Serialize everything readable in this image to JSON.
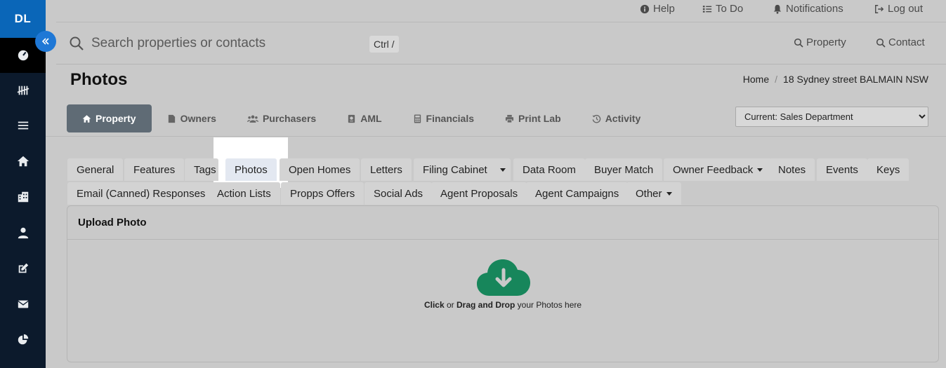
{
  "sidebar": {
    "brand": "DL",
    "items": [
      {
        "icon": "dashboard-icon"
      },
      {
        "icon": "tally-icon"
      },
      {
        "icon": "list-icon"
      },
      {
        "icon": "home-icon"
      },
      {
        "icon": "building-icon"
      },
      {
        "icon": "user-icon"
      },
      {
        "icon": "edit-icon"
      },
      {
        "icon": "envelope-icon"
      },
      {
        "icon": "pie-chart-icon"
      }
    ]
  },
  "utilbar": {
    "help": "Help",
    "todo": "To Do",
    "notifications": "Notifications",
    "logout": "Log out"
  },
  "search": {
    "placeholder": "Search properties or contacts",
    "shortcut": "Ctrl /",
    "property_link": "Property",
    "contact_link": "Contact"
  },
  "page": {
    "title": "Photos",
    "breadcrumb": [
      "Home",
      "18 Sydney street BALMAIN NSW"
    ]
  },
  "main_tabs": [
    {
      "label": "Property",
      "icon": "home-icon",
      "active": true
    },
    {
      "label": "Owners",
      "icon": "file-icon"
    },
    {
      "label": "Purchasers",
      "icon": "users-icon"
    },
    {
      "label": "AML",
      "icon": "passport-icon"
    },
    {
      "label": "Financials",
      "icon": "calculator-icon"
    },
    {
      "label": "Print Lab",
      "icon": "printer-icon"
    },
    {
      "label": "Activity",
      "icon": "history-icon"
    }
  ],
  "department": {
    "selected": "Current: Sales Department"
  },
  "sub_tabs_row1": [
    "General",
    "Features",
    "Tags",
    "Photos",
    "Open Homes",
    "Letters",
    "Filing Cabinet",
    "Data Room",
    "Buyer Match",
    "Owner Feedback",
    "Notes",
    "Events",
    "Keys"
  ],
  "sub_tabs_row2": [
    "Email (Canned) Responses",
    "Action Lists",
    "Propps Offers",
    "Social Ads",
    "Agent Proposals",
    "Agent Campaigns",
    "Other"
  ],
  "upload": {
    "title": "Upload Photo",
    "click": "Click",
    "or": "or",
    "drag": "Drag and Drop",
    "suffix": "your Photos here"
  },
  "colors": {
    "sidebar": "#0c1a2c",
    "brand": "#0a66b8",
    "active_tab": "#5f6b75",
    "cloud": "#17865b"
  }
}
